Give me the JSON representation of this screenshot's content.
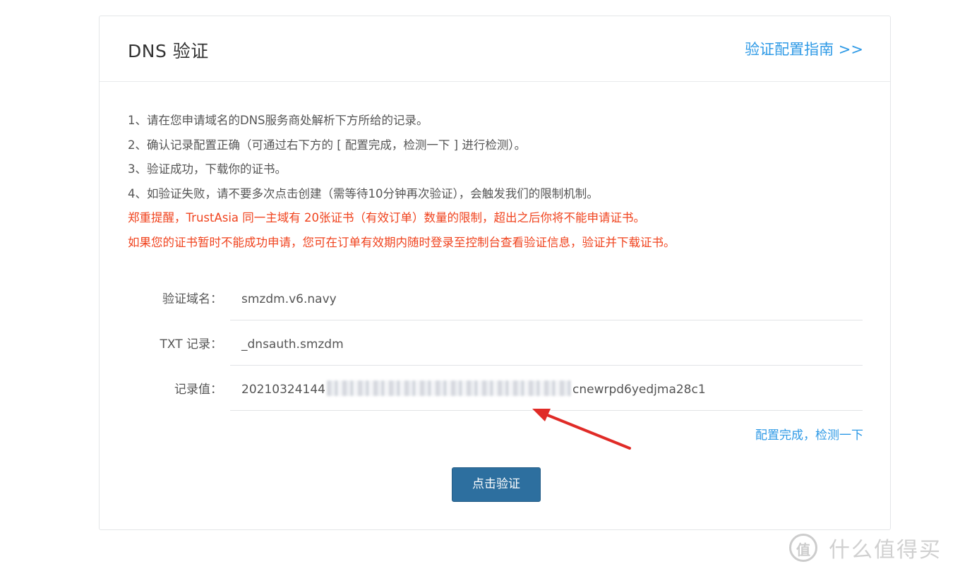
{
  "header": {
    "title": "DNS 验证",
    "guide_link": "验证配置指南 >>"
  },
  "instructions": [
    "1、请在您申请域名的DNS服务商处解析下方所给的记录。",
    "2、确认记录配置正确（可通过右下方的 [ 配置完成，检测一下 ] 进行检测）。",
    "3、验证成功，下载你的证书。",
    "4、如验证失败，请不要多次点击创建（需等待10分钟再次验证），会触发我们的限制机制。"
  ],
  "warnings": [
    "郑重提醒，TrustAsia 同一主域有 20张证书（有效订单）数量的限制，超出之后你将不能申请证书。",
    "如果您的证书暂时不能成功申请，您可在订单有效期内随时登录至控制台查看验证信息，验证并下载证书。"
  ],
  "fields": {
    "domain": {
      "label": "验证域名：",
      "value": "smzdm.v6.navy"
    },
    "txt": {
      "label": "TXT 记录：",
      "value": "_dnsauth.smzdm"
    },
    "record": {
      "label": "记录值：",
      "value_start": "20210324144",
      "value_end": "cnewrpd6yedjma28c1"
    }
  },
  "detect_link": "配置完成，检测一下",
  "verify_button": "点击验证",
  "watermark": {
    "logo": "值",
    "text": "什么值得买"
  },
  "colors": {
    "link": "#2f9ae6",
    "warning": "#f0431e",
    "button": "#2d6f9f",
    "arrow": "#e02b27"
  }
}
